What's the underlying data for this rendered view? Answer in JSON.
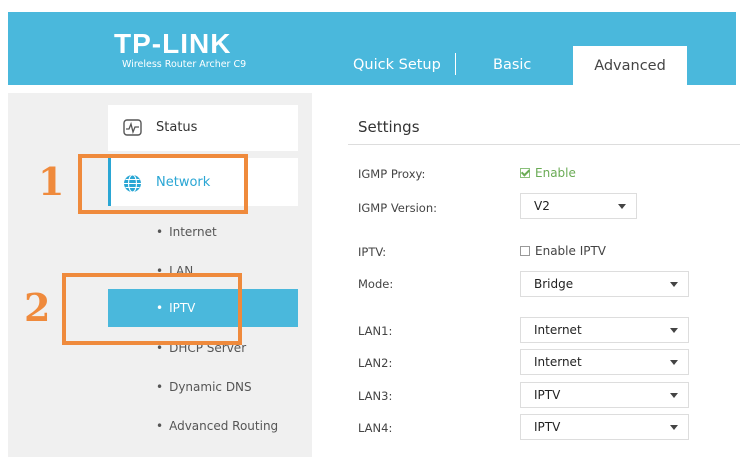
{
  "header": {
    "logo": "TP-LINK",
    "tagline": "Wireless Router Archer C9",
    "tabs": [
      "Quick Setup",
      "Basic",
      "Advanced"
    ]
  },
  "sidebar": {
    "status": "Status",
    "network": "Network",
    "subitems": [
      "Internet",
      "LAN",
      "IPTV",
      "DHCP Server",
      "Dynamic DNS",
      "Advanced Routing"
    ]
  },
  "annotations": {
    "step1": "1",
    "step2": "2"
  },
  "settings": {
    "title": "Settings",
    "igmp_proxy_label": "IGMP Proxy:",
    "igmp_proxy_value": "Enable",
    "igmp_version_label": "IGMP Version:",
    "igmp_version_value": "V2",
    "iptv_label": "IPTV:",
    "iptv_value": "Enable IPTV",
    "mode_label": "Mode:",
    "mode_value": "Bridge",
    "lan1_label": "LAN1:",
    "lan1_value": "Internet",
    "lan2_label": "LAN2:",
    "lan2_value": "Internet",
    "lan3_label": "LAN3:",
    "lan3_value": "IPTV",
    "lan4_label": "LAN4:",
    "lan4_value": "IPTV"
  },
  "colors": {
    "brand": "#4ab8dc",
    "annotation": "#ef8a3c",
    "enabled": "#6aab55"
  }
}
